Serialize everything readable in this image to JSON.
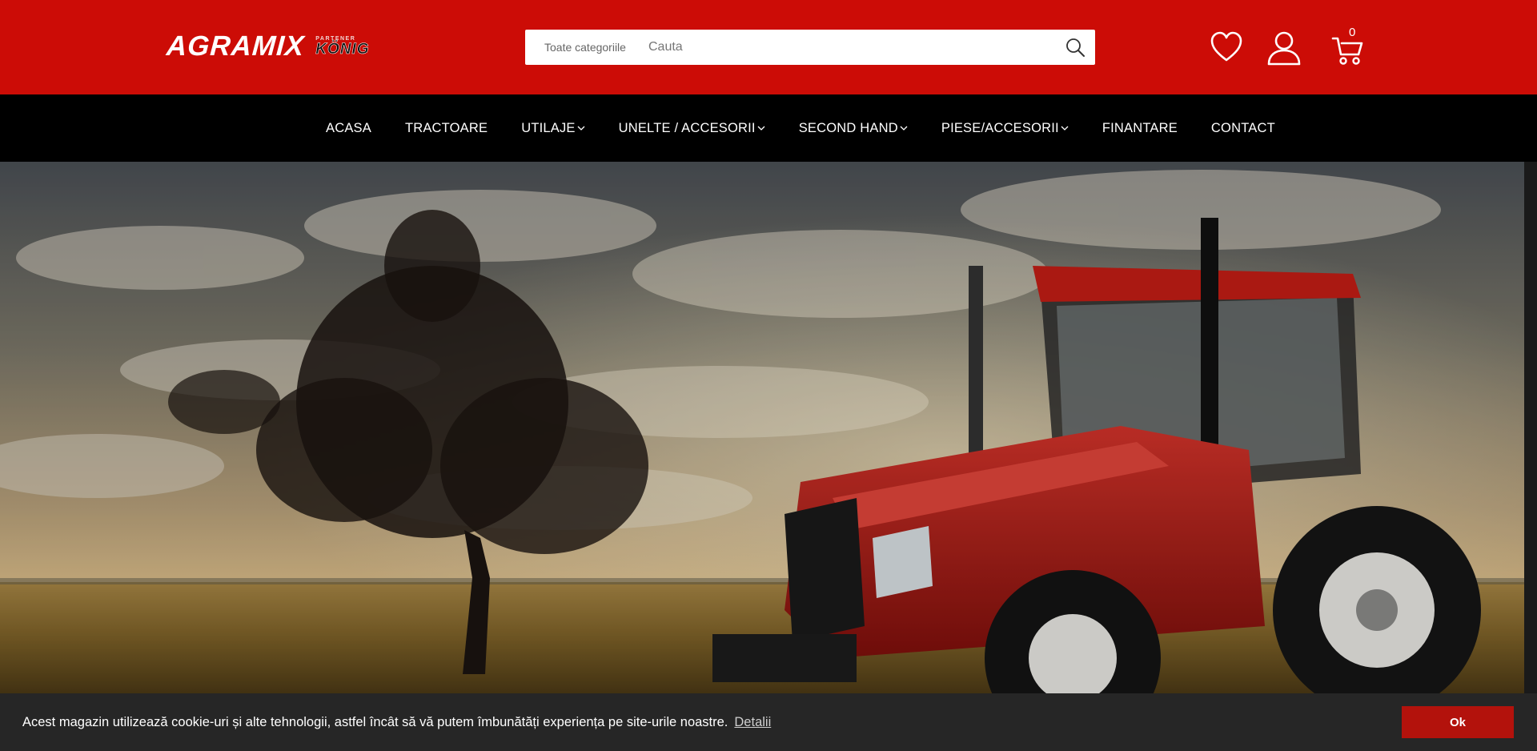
{
  "header": {
    "logo_main": "AGRAMIX",
    "logo_partner_small": "PARTENER",
    "logo_partner_brand": "KÖNIG",
    "search": {
      "category": "Toate categoriile",
      "placeholder": "Cauta"
    },
    "cart_count": "0",
    "icons": [
      "heart-icon",
      "user-icon",
      "cart-icon",
      "search-icon"
    ]
  },
  "nav": {
    "items": [
      {
        "label": "ACASA",
        "dropdown": false
      },
      {
        "label": "TRACTOARE",
        "dropdown": false
      },
      {
        "label": "UTILAJE",
        "dropdown": true
      },
      {
        "label": "UNELTE / ACCESORII",
        "dropdown": true
      },
      {
        "label": "SECOND HAND",
        "dropdown": true
      },
      {
        "label": "PIESE/ACCESORII",
        "dropdown": true
      },
      {
        "label": "FINANTARE",
        "dropdown": false
      },
      {
        "label": "CONTACT",
        "dropdown": false
      }
    ]
  },
  "cookie": {
    "text": "Acest magazin utilizează cookie-uri și alte tehnologii, astfel încât să vă putem îmbunătăți experiența pe site-urile noastre.",
    "link": "Detalii",
    "button": "Ok"
  },
  "colors": {
    "brand_red": "#cc0c06",
    "nav_bg": "#000000",
    "cookie_bg": "#262626",
    "cookie_button": "#b3120c"
  }
}
